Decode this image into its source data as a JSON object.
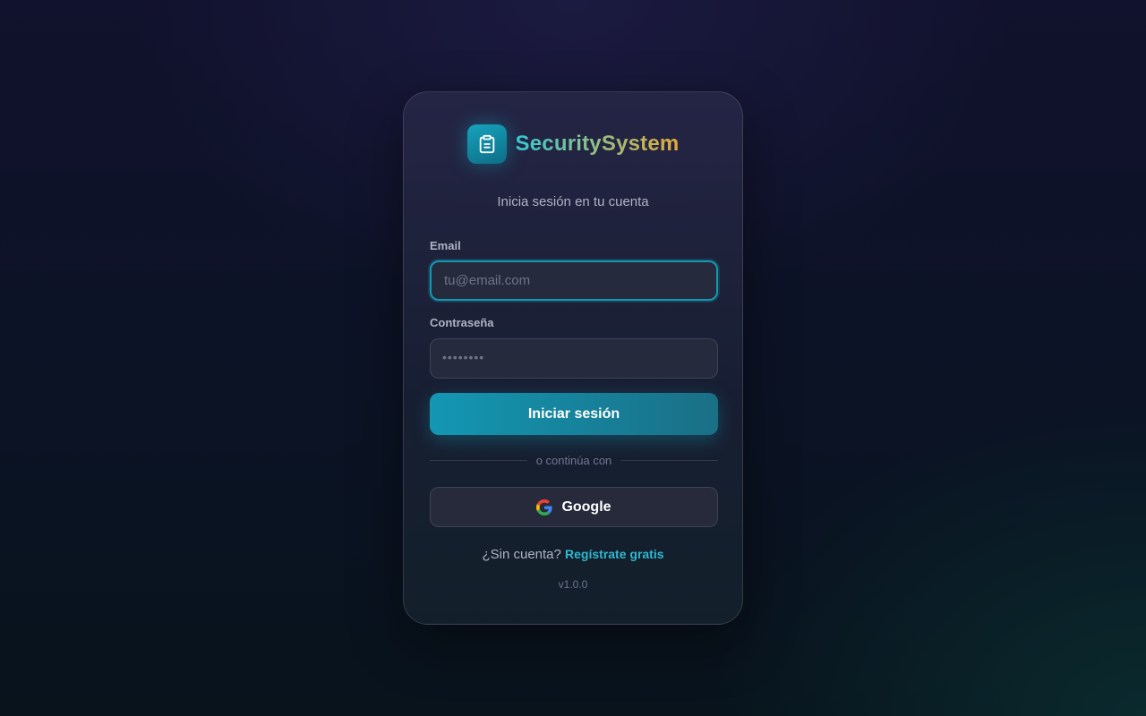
{
  "brand": {
    "name": "SecuritySystem",
    "icon": "clipboard-icon"
  },
  "login": {
    "subtitle": "Inicia sesión en tu cuenta",
    "email_label": "Email",
    "email_placeholder": "tu@email.com",
    "email_value": "",
    "password_label": "Contraseña",
    "password_placeholder": "••••••••",
    "submit_label": "Iniciar sesión",
    "divider_text": "o continúa con",
    "google_label": "Google",
    "signup_prompt": "¿Sin cuenta?",
    "signup_link": "Regístrate gratis",
    "version": "v1.0.0"
  },
  "colors": {
    "accent": "#1597b0",
    "link": "#2fb8d0",
    "brand_gradient_start": "#34c7d4",
    "brand_gradient_end": "#e2aa3a"
  }
}
